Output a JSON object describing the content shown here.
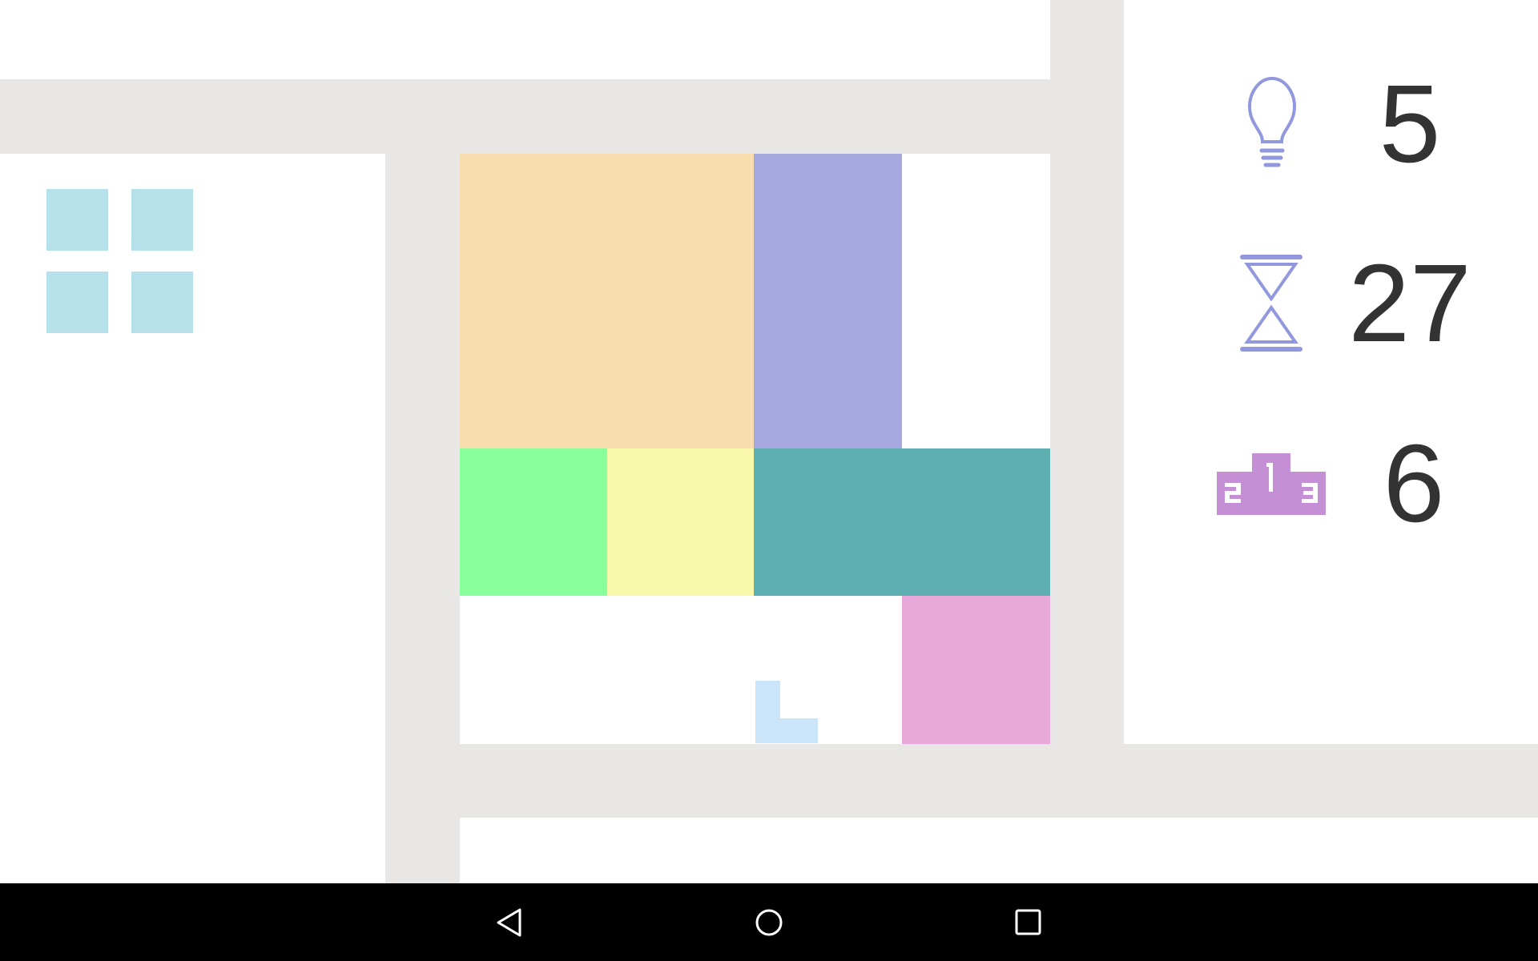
{
  "stats": {
    "hints": {
      "icon": "lightbulb-icon",
      "value": "5"
    },
    "timer": {
      "icon": "hourglass-icon",
      "value": "27"
    },
    "rank": {
      "icon": "podium-icon",
      "value": "6"
    }
  },
  "menu": {
    "icon": "grid-menu-icon"
  },
  "board": {
    "background": "#ffffff",
    "frame_color": "#e8e7e6",
    "pieces": [
      {
        "id": "orange-block",
        "color": "#f8deae"
      },
      {
        "id": "purple-block",
        "color": "#a8a8e0"
      },
      {
        "id": "green-block",
        "color": "#88ff9b"
      },
      {
        "id": "yellow-block",
        "color": "#f8f8aa"
      },
      {
        "id": "teal-block",
        "color": "#5eafb2"
      },
      {
        "id": "pink-block",
        "color": "#e8a8d9"
      }
    ],
    "cursor_piece": {
      "id": "l-shape-piece",
      "color": "#cbe6fa"
    }
  },
  "colors": {
    "icon_blue": "#9298dd",
    "icon_purple": "#c58fd6",
    "menu_squares": "#b6e0ea"
  },
  "navigation": {
    "back": "back-icon",
    "home": "home-icon",
    "recents": "recents-icon"
  }
}
